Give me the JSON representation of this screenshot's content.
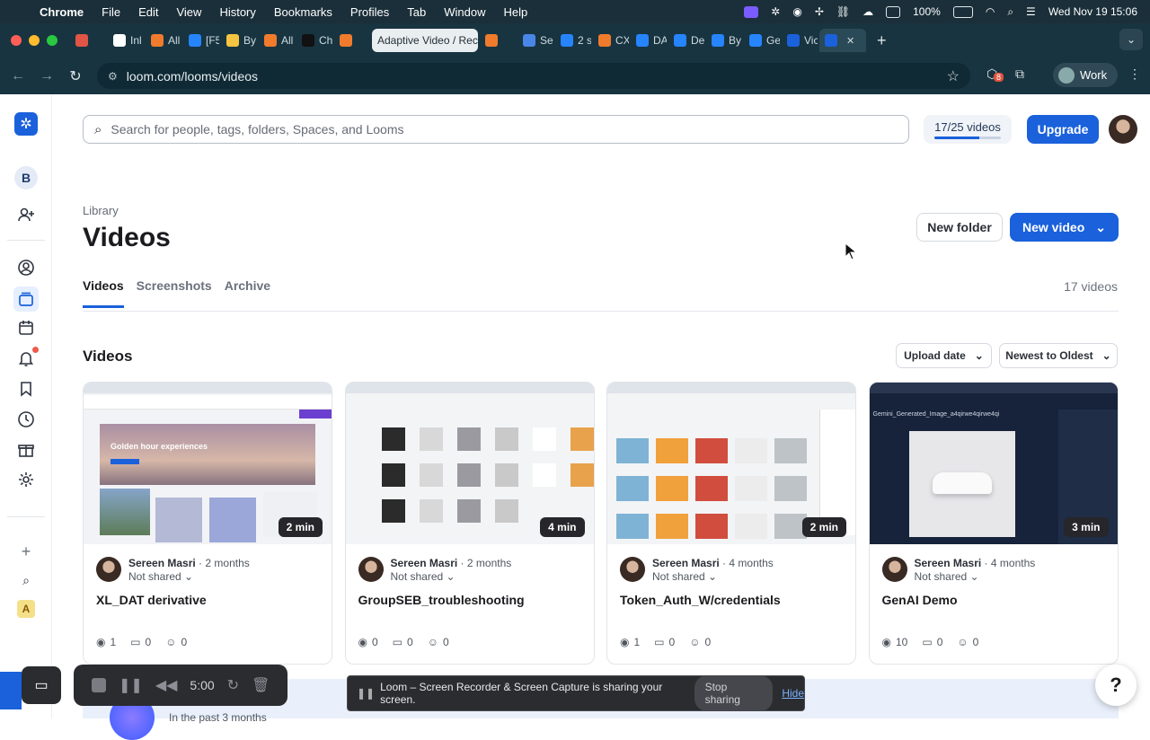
{
  "menubar": {
    "app": "Chrome",
    "items": [
      "File",
      "Edit",
      "View",
      "History",
      "Bookmarks",
      "Profiles",
      "Tab",
      "Window",
      "Help"
    ],
    "battery": "100%",
    "datetime": "Wed Nov 19  15:06"
  },
  "tabs": [
    {
      "label": "",
      "color": "#e05545"
    },
    {
      "label": "Inl",
      "color": "#ffffff"
    },
    {
      "label": "All",
      "color": "#f17b2c"
    },
    {
      "label": "[F5",
      "color": "#2684ff"
    },
    {
      "label": "By",
      "color": "#f5c542"
    },
    {
      "label": "All",
      "color": "#f17b2c"
    },
    {
      "label": "Ch",
      "color": "#111111"
    },
    {
      "label": "",
      "color": "#f17b2c"
    },
    {
      "label": "Adaptive Video / Rec",
      "color": "",
      "active": true
    },
    {
      "label": "",
      "color": "#f17b2c"
    },
    {
      "label": "Se",
      "color": "#4a86e8"
    },
    {
      "label": "2 s",
      "color": "#2684ff"
    },
    {
      "label": "CX",
      "color": "#f17b2c"
    },
    {
      "label": "DA",
      "color": "#2684ff"
    },
    {
      "label": "De",
      "color": "#2684ff"
    },
    {
      "label": "By",
      "color": "#2684ff"
    },
    {
      "label": "Ge",
      "color": "#2684ff"
    },
    {
      "label": "Vic",
      "color": "#1a61db"
    },
    {
      "label": "",
      "color": "#1a61db",
      "current": true
    }
  ],
  "toolbar": {
    "url": "loom.com/looms/videos",
    "ext_badge": "8",
    "profile": "Work"
  },
  "header": {
    "search_placeholder": "Search for people, tags, folders, Spaces, and Looms",
    "quota_label": "17/25 videos",
    "quota_fraction": 0.68,
    "upgrade_label": "Upgrade"
  },
  "leftnav": {
    "workspace": "B",
    "workspace2": "A"
  },
  "page": {
    "breadcrumb": "Library",
    "title": "Videos",
    "new_folder_label": "New folder",
    "new_video_label": "New video",
    "tabs": [
      "Videos",
      "Screenshots",
      "Archive"
    ],
    "count": "17 videos",
    "section_title": "Videos",
    "sort_field": "Upload date",
    "sort_order": "Newest to Oldest"
  },
  "videos": [
    {
      "author": "Sereen Masri",
      "age": "2 months",
      "sharing": "Not shared",
      "title": "XL_DAT derivative",
      "duration": "2 min",
      "views": "1",
      "comments": "0",
      "reactions": "0"
    },
    {
      "author": "Sereen Masri",
      "age": "2 months",
      "sharing": "Not shared",
      "title": "GroupSEB_troubleshooting",
      "duration": "4 min",
      "views": "0",
      "comments": "0",
      "reactions": "0"
    },
    {
      "author": "Sereen Masri",
      "age": "4 months",
      "sharing": "Not shared",
      "title": "Token_Auth_W/credentials",
      "duration": "2 min",
      "views": "1",
      "comments": "0",
      "reactions": "0"
    },
    {
      "author": "Sereen Masri",
      "age": "4 months",
      "sharing": "Not shared",
      "title": "GenAI Demo",
      "duration": "3 min",
      "views": "10",
      "comments": "0",
      "reactions": "0"
    }
  ],
  "bottom": {
    "hint": "In the past 3 months"
  },
  "recorder": {
    "time": "5:00"
  },
  "sharebar": {
    "message": "Loom – Screen Recorder & Screen Capture is sharing your screen.",
    "stop_label": "Stop sharing",
    "hide_label": "Hide"
  },
  "help_label": "?"
}
